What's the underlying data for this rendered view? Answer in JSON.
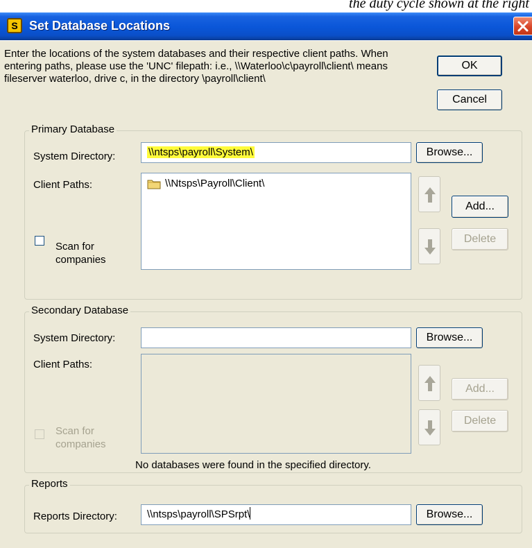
{
  "background_text": "the duty cycle shown at the right",
  "window": {
    "title": "Set Database Locations",
    "app_icon_letter": "S"
  },
  "instructions": "Enter the locations of the system databases and their respective client paths.  When entering paths, please use the 'UNC' filepath:  i.e., \\\\Waterloo\\c\\payroll\\client\\ means fileserver waterloo, drive c, in the directory \\payroll\\client\\",
  "buttons": {
    "ok": "OK",
    "cancel": "Cancel"
  },
  "primary": {
    "group_title": "Primary Database",
    "system_dir_label": "System Directory:",
    "system_dir_value": "\\\\ntsps\\payroll\\System\\",
    "browse_label": "Browse...",
    "client_paths_label": "Client Paths:",
    "client_paths": [
      "\\\\Ntsps\\Payroll\\Client\\"
    ],
    "add_label": "Add...",
    "delete_label": "Delete",
    "scan_line1": "Scan for",
    "scan_line2": "companies"
  },
  "secondary": {
    "group_title": "Secondary Database",
    "system_dir_label": "System Directory:",
    "system_dir_value": "",
    "browse_label": "Browse...",
    "client_paths_label": "Client Paths:",
    "add_label": "Add...",
    "delete_label": "Delete",
    "scan_line1": "Scan for",
    "scan_line2": "companies",
    "no_db_message": "No databases were found in the specified directory."
  },
  "reports": {
    "group_title": "Reports",
    "dir_label": "Reports Directory:",
    "dir_value": "\\\\ntsps\\payroll\\SPSrpt\\",
    "browse_label": "Browse..."
  },
  "colors": {
    "title_bar": "#0a56d8",
    "dialog_bg": "#ece9d8",
    "highlight": "#fffb3a",
    "close_button": "#d8462a"
  }
}
